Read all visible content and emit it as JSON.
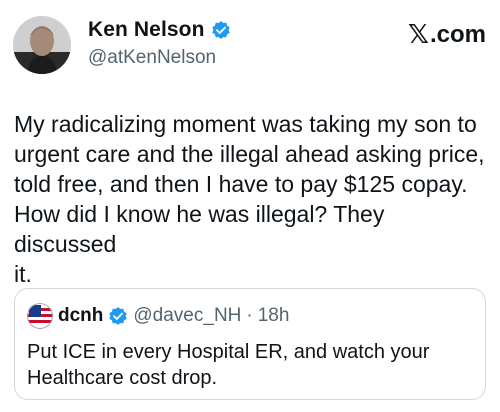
{
  "author": {
    "name": "Ken Nelson",
    "handle": "@atKenNelson",
    "verified": true
  },
  "brand": {
    "label": ".com",
    "icon": "x-logo-icon"
  },
  "tweet": {
    "text": "My radicalizing moment was taking my son to\nurgent care and the illegal ahead asking price,\ntold free, and then I have to pay $125 copay.\nHow did I  know he was illegal? They discussed\nit."
  },
  "quoted_tweet": {
    "name": "dcnh",
    "handle": "@davec_NH",
    "separator": "·",
    "time": "18h",
    "verified": true,
    "text": "Put ICE in every Hospital ER, and watch your\nHealthcare cost drop."
  },
  "colors": {
    "verified_blue": "#1d9bf0",
    "secondary_text": "#536471",
    "border": "#cfd9de"
  }
}
